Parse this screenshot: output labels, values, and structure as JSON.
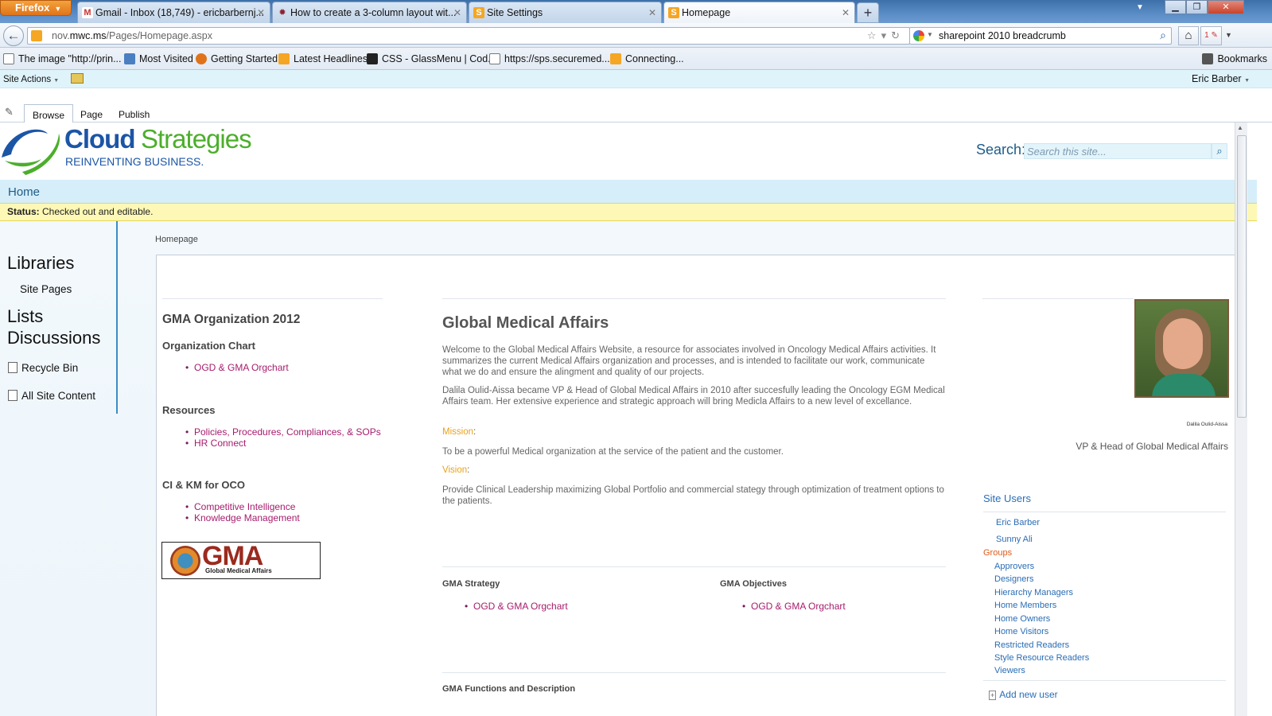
{
  "browser": {
    "menu_button": "Firefox",
    "tabs": [
      {
        "title": "Gmail - Inbox (18,749) - ericbarbernj...",
        "icon": "gmail-icon"
      },
      {
        "title": "How to create a 3-column layout wit...",
        "icon": "gear-icon"
      },
      {
        "title": "Site Settings",
        "icon": "sharepoint-icon"
      },
      {
        "title": "Homepage",
        "icon": "sharepoint-icon"
      }
    ],
    "new_tab": "+",
    "url_host_pre": "nov.",
    "url_host": "mwc.ms",
    "url_path": "/Pages/Homepage.aspx",
    "search_query": "sharepoint 2010 breadcrumb",
    "addon_badge": "1",
    "bookmarks": [
      {
        "label": "The image \"http://prin...",
        "icon": "page-icon"
      },
      {
        "label": "Most Visited",
        "icon": "most-visited-icon"
      },
      {
        "label": "Getting Started",
        "icon": "firefox-icon"
      },
      {
        "label": "Latest Headlines",
        "icon": "rss-icon"
      },
      {
        "label": "CSS - GlassMenu | Cod...",
        "icon": "codepen-icon"
      },
      {
        "label": "https://sps.securemed...",
        "icon": "page-icon"
      },
      {
        "label": "Connecting...",
        "icon": "sharepoint-icon"
      }
    ],
    "bookmarks_menu": "Bookmarks"
  },
  "sharepoint": {
    "site_actions": "Site Actions",
    "user": "Eric Barber",
    "ribbon_tabs": [
      "Browse",
      "Page",
      "Publish"
    ],
    "logo": {
      "word1": "Cloud",
      "word2": "Strategies",
      "tagline": "REINVENTING BUSINESS."
    },
    "search": {
      "label": "Search:",
      "placeholder": "Search this site..."
    },
    "topnav": "Home",
    "status": {
      "label": "Status:",
      "text": " Checked out and editable."
    },
    "quicklaunch": {
      "libraries": "Libraries",
      "site_pages": "Site Pages",
      "lists": "Lists",
      "discussions": "Discussions",
      "recycle_bin": "Recycle Bin",
      "all_content": "All Site Content"
    },
    "breadcrumb": "Homepage"
  },
  "page": {
    "left": {
      "title": "GMA Organization 2012",
      "org_chart_heading": "Organization Chart",
      "org_chart_links": [
        "OGD & GMA Orgchart"
      ],
      "resources_heading": "Resources",
      "resources_links": [
        "Policies, Procedures, Compliances, & SOPs",
        "HR Connect"
      ],
      "ci_heading": "CI & KM for OCO",
      "ci_links": [
        "Competitive Intelligence",
        "Knowledge Management"
      ],
      "gma_logo_text": "GMA",
      "gma_logo_sub": "Global Medical Affairs"
    },
    "center": {
      "title": "Global Medical Affairs",
      "p1": "Welcome to the Global Medical Affairs Website, a resource for associates involved in Oncology Medical Affairs activities. It summarizes the current Medical Affairs organization and processes, and is intended to facilitate our work, communicate what we do and ensure the alingment and quality of our projects.",
      "p2": "Dalila Oulid-Aissa became VP & Head of Global Medical Affairs in 2010 after succesfully leading the Oncology EGM Medical Affairs team. Her extensive experience and strategic approach will bring Medicla Affairs to a new level of excellance.",
      "mission_label": "Mission",
      "mission_text": "To be a powerful Medical organization at the service of the patient and the customer.",
      "vision_label": "Vision",
      "vision_text": "Provide Clinical Leadership maximizing Global Portfolio and commercial stategy through optimization of treatment options to the patients.",
      "strategy_heading": "GMA Strategy",
      "strategy_link": "OGD & GMA Orgchart",
      "objectives_heading": "GMA Objectives",
      "objectives_link": "OGD & GMA Orgchart",
      "functions_heading": "GMA Functions and Description"
    },
    "right": {
      "photo_caption": "Dalila Oulid-Aissa",
      "role": "VP & Head of Global Medical Affairs",
      "site_users_heading": "Site Users",
      "users": [
        "Eric Barber",
        "Sunny Ali"
      ],
      "groups_label": "Groups",
      "groups": [
        "Approvers",
        "Designers",
        "Hierarchy Managers",
        "Home Members",
        "Home Owners",
        "Home Visitors",
        "Restricted Readers",
        "Style Resource Readers",
        "Viewers"
      ],
      "add_user": "Add new user"
    }
  },
  "colors": {
    "link": "#a61c6d",
    "accent_blue": "#1d5c8a",
    "status_bg": "#fdf8b5",
    "orange_label": "#e8a21a"
  }
}
